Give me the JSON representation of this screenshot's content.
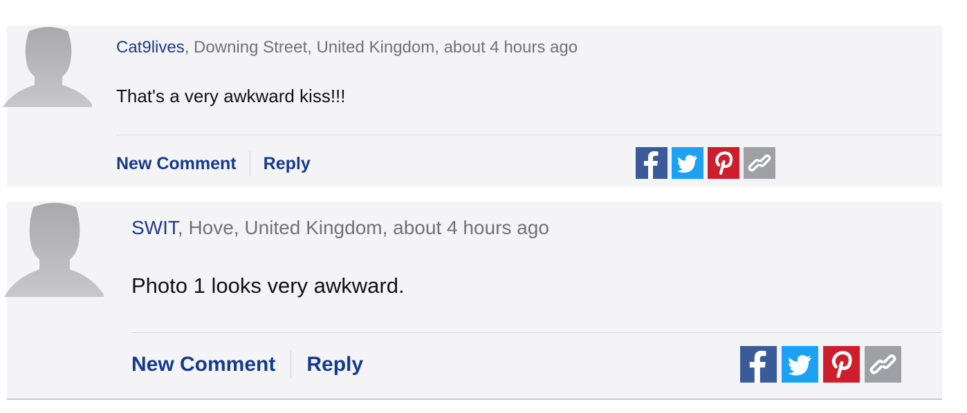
{
  "comments": [
    {
      "author": "Cat9lives",
      "meta": ", Downing Street, United Kingdom, about 4 hours ago",
      "text": "That's a very awkward kiss!!!",
      "actions": {
        "new_comment": "New Comment",
        "reply": "Reply"
      },
      "share_icons": [
        "facebook-icon",
        "twitter-icon",
        "pinterest-icon",
        "link-icon"
      ]
    },
    {
      "author": "SWIT",
      "meta": ", Hove, United Kingdom, about 4 hours ago",
      "text": "Photo 1 looks very awkward.",
      "actions": {
        "new_comment": "New Comment",
        "reply": "Reply"
      },
      "share_icons": [
        "facebook-icon",
        "twitter-icon",
        "pinterest-icon",
        "link-icon"
      ]
    }
  ],
  "colors": {
    "author": "#1c3a8c",
    "action_link": "#153a8d",
    "panel_bg": "#f4f4f6",
    "facebook": "#3a5a99",
    "twitter": "#1da1f2",
    "pinterest": "#cc1f2b",
    "link": "#9ea0a5"
  }
}
